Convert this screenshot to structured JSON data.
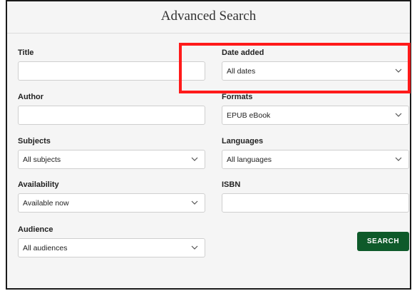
{
  "header": {
    "title": "Advanced Search"
  },
  "form": {
    "title": {
      "label": "Title",
      "value": ""
    },
    "date_added": {
      "label": "Date added",
      "value": "All dates"
    },
    "author": {
      "label": "Author",
      "value": ""
    },
    "formats": {
      "label": "Formats",
      "value": "EPUB eBook"
    },
    "subjects": {
      "label": "Subjects",
      "value": "All subjects"
    },
    "languages": {
      "label": "Languages",
      "value": "All languages"
    },
    "availability": {
      "label": "Availability",
      "value": "Available now"
    },
    "isbn": {
      "label": "ISBN",
      "value": ""
    },
    "audience": {
      "label": "Audience",
      "value": "All audiences"
    },
    "search_label": "SEARCH"
  },
  "icons": {
    "dropdown": "chevron-down-icon"
  },
  "colors": {
    "search_button": "#0e5a2a",
    "highlight": "#ff1a1a"
  }
}
